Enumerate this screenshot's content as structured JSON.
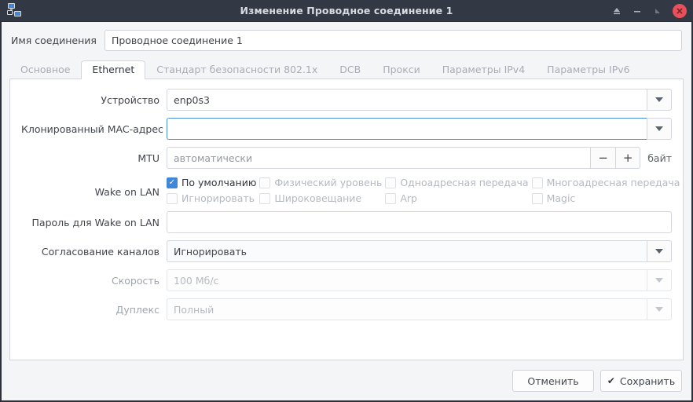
{
  "titlebar": {
    "title": "Изменение Проводное соединение 1",
    "app_icon": "network-computers-icon",
    "controls": {
      "eject_label": "⏏",
      "minimize_label": "–",
      "maximize_label": "❐",
      "close_label": "✕"
    }
  },
  "connection_name": {
    "label": "Имя соединения",
    "value": "Проводное соединение 1",
    "placeholder": ""
  },
  "tabs": [
    {
      "label": "Основное",
      "active": false
    },
    {
      "label": "Ethernet",
      "active": true
    },
    {
      "label": "Стандарт безопасности 802.1x",
      "active": false
    },
    {
      "label": "DCB",
      "active": false
    },
    {
      "label": "Прокси",
      "active": false
    },
    {
      "label": "Параметры IPv4",
      "active": false
    },
    {
      "label": "Параметры IPv6",
      "active": false
    }
  ],
  "form": {
    "device": {
      "label": "Устройство",
      "value": "enp0s3"
    },
    "cloned_mac": {
      "label": "Клонированный MAC-адрес",
      "value": "",
      "placeholder": ""
    },
    "mtu": {
      "label": "MTU",
      "value": "автоматически",
      "minus_label": "−",
      "plus_label": "+",
      "unit": "байт"
    },
    "wake_on_lan": {
      "label": "Wake on LAN",
      "options": [
        {
          "label": "По умолчанию",
          "checked": true,
          "enabled": true
        },
        {
          "label": "Физический уровень",
          "checked": false,
          "enabled": false
        },
        {
          "label": "Одноадресная передача",
          "checked": false,
          "enabled": false
        },
        {
          "label": "Многоадресная передача",
          "checked": false,
          "enabled": false
        },
        {
          "label": "Игнорировать",
          "checked": false,
          "enabled": false
        },
        {
          "label": "Широковещание",
          "checked": false,
          "enabled": false
        },
        {
          "label": "Arp",
          "checked": false,
          "enabled": false
        },
        {
          "label": "Magic",
          "checked": false,
          "enabled": false
        }
      ]
    },
    "wol_password": {
      "label": "Пароль для Wake on LAN",
      "value": "",
      "placeholder": ""
    },
    "link_negotiation": {
      "label": "Согласование каналов",
      "value": "Игнорировать"
    },
    "speed": {
      "label": "Скорость",
      "value": "100 Мб/с"
    },
    "duplex": {
      "label": "Дуплекс",
      "value": "Полный"
    }
  },
  "footer": {
    "cancel_label": "Отменить",
    "save_label": "Сохранить",
    "save_icon": "✔"
  },
  "colors": {
    "titlebar_bg": "#323844",
    "close_button": "#e8505b",
    "accent_focus": "#4a90d9",
    "checkbox_checked": "#3f87d8"
  }
}
